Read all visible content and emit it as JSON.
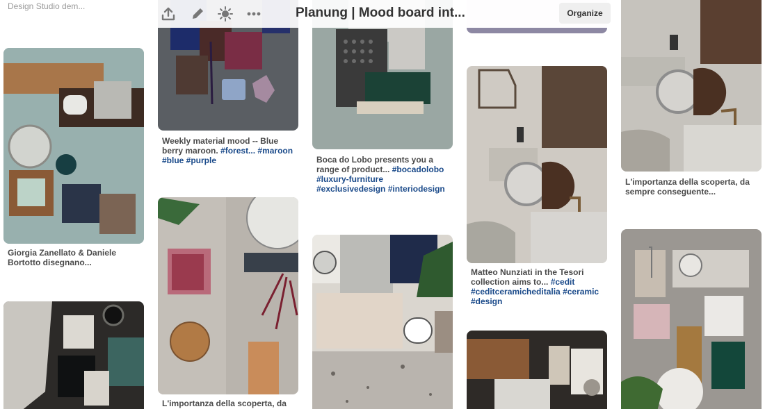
{
  "header": {
    "title": "Planung | Mood board int...",
    "organize_label": "Organize",
    "icons": [
      "upload-icon",
      "edit-icon",
      "sparkle-icon",
      "more-icon"
    ]
  },
  "pins": {
    "col1_top_caption": "For this Moodboard Studio Note Design Studio dem...",
    "col1_pin1": "Giorgia Zanellato & Daniele Bortotto disegnano...",
    "col2_pin1_text": "Weekly material mood -- Blue berry maroon.",
    "col2_pin1_tags": "#forest... #maroon #blue #purple",
    "col2_pin2": "L'importanza della scoperta, da",
    "col3_pin1_text": "Boca do Lobo presents you a range of product...",
    "col3_pin1_tags": "#bocadolobo #luxury-furniture #exclusivedesign #interiodesign",
    "col4_pin1_text": "Matteo Nunziati in the Tesori collection aims to...",
    "col4_pin1_tags": "#cedit #ceditceramicheditalia #ceramic #design",
    "col5_pin1": "L'importanza della scoperta, da sempre conseguente..."
  },
  "colors": {
    "caption": "#4a4a4a",
    "tag": "#1a4a8a",
    "button_bg": "#efefef",
    "title": "#333333"
  }
}
